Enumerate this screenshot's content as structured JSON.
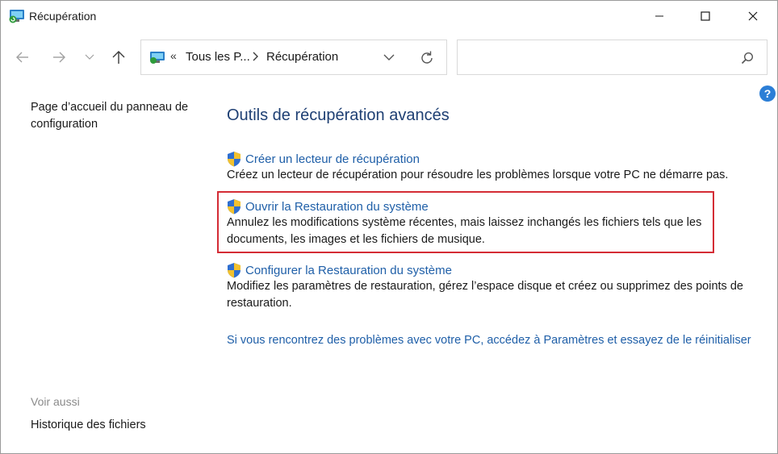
{
  "window": {
    "title": "Récupération"
  },
  "address": {
    "chevrons": "«",
    "segment1": "Tous les P...",
    "segment2": "Récupération"
  },
  "search": {
    "placeholder": ""
  },
  "left_panel": {
    "home_link": "Page d’accueil du panneau de configuration",
    "see_also": "Voir aussi",
    "history_link": "Historique des fichiers"
  },
  "main": {
    "title": "Outils de récupération avancés",
    "tasks": [
      {
        "link": "Créer un lecteur de récupération",
        "desc": "Créez un lecteur de récupération pour résoudre les problèmes lorsque votre PC ne démarre pas."
      },
      {
        "link": "Ouvrir la Restauration du système",
        "desc": "Annulez les modifications système récentes, mais laissez inchangés les fichiers tels que les documents, les images et les fichiers de musique."
      },
      {
        "link": "Configurer la Restauration du système",
        "desc": "Modifiez les paramètres de restauration, gérez l’espace disque et créez ou supprimez des points de restauration."
      }
    ],
    "reset_link": "Si vous rencontrez des problèmes avec votre PC, accédez à Paramètres et essayez de le réinitialiser"
  },
  "help_label": "?",
  "colors": {
    "link": "#1f5fa8",
    "title": "#1e3f73",
    "highlight": "#d42c35"
  },
  "icons": {
    "app": "recovery-icon",
    "shield": "uac-shield-icon",
    "search": "search-icon",
    "help": "help-icon"
  }
}
